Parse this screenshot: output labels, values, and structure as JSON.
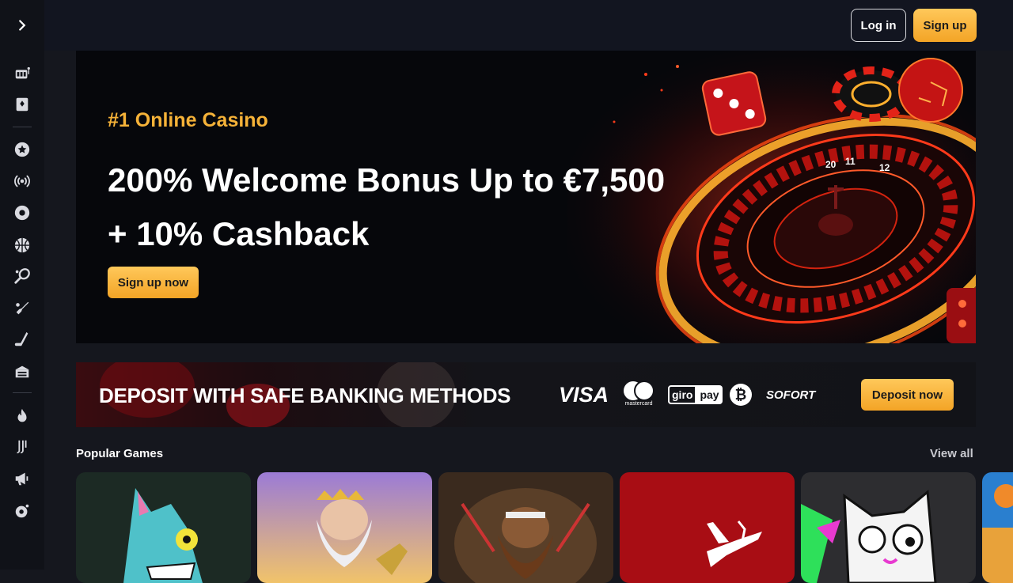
{
  "sidebar": {
    "toggle_icon": "chevron-right-icon",
    "items": [
      {
        "icon": "casino-icon"
      },
      {
        "icon": "cards-icon"
      },
      {
        "icon": "star-icon"
      },
      {
        "icon": "live-icon"
      },
      {
        "icon": "football-icon"
      },
      {
        "icon": "basketball-icon"
      },
      {
        "icon": "tennis-icon"
      },
      {
        "icon": "cricket-icon"
      },
      {
        "icon": "hockey-icon"
      },
      {
        "icon": "stadium-icon"
      },
      {
        "icon": "fire-icon"
      },
      {
        "icon": "juventus-icon"
      },
      {
        "icon": "megaphone-icon"
      },
      {
        "icon": "support-icon"
      }
    ]
  },
  "header": {
    "login_label": "Log in",
    "signup_label": "Sign up"
  },
  "hero": {
    "tagline": "#1 Online Casino",
    "title_line1": "200% Welcome Bonus Up to €7,500",
    "title_line2": "+ 10% Cashback",
    "cta_label": "Sign up now",
    "roulette_numbers": [
      "20",
      "11",
      "12"
    ]
  },
  "banking": {
    "title": "DEPOSIT WITH SAFE BANKING METHODS",
    "methods": {
      "visa": "VISA",
      "mastercard": "mastercard",
      "giropay_left": "giro",
      "giropay_right": "pay",
      "bitcoin": "₿",
      "sofort": "SOFORT"
    },
    "cta_label": "Deposit now"
  },
  "popular": {
    "title": "Popular Games",
    "view_all_label": "View all",
    "games": [
      {
        "theme": "cat-cartoon"
      },
      {
        "theme": "zeus"
      },
      {
        "theme": "viking-warrior"
      },
      {
        "theme": "aviator-plane"
      },
      {
        "theme": "cat-character"
      },
      {
        "theme": "partial-card"
      }
    ]
  },
  "colors": {
    "accent": "#f5b238",
    "button_gradient_top": "#ffc85a",
    "button_gradient_bottom": "#f3a426",
    "page_bg": "#15171e",
    "sidebar_bg": "#101218"
  }
}
